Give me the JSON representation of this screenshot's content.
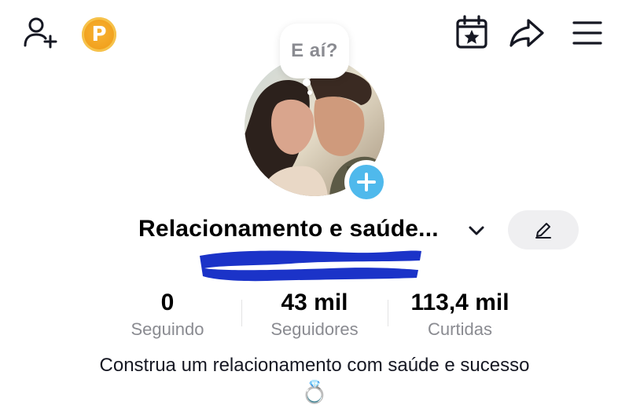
{
  "speech_bubble": {
    "text": "E aí?"
  },
  "header": {
    "add_user_icon": "person-plus-icon",
    "coin_icon": "coin-icon",
    "coin_label": "P",
    "calendar_icon": "calendar-star-icon",
    "share_icon": "share-arrow-icon",
    "menu_icon": "hamburger-menu-icon"
  },
  "profile": {
    "display_name": "Relacionamento e saúde...",
    "edit_icon": "pencil-icon",
    "dropdown_icon": "chevron-down-icon"
  },
  "stats": [
    {
      "value": "0",
      "label": "Seguindo"
    },
    {
      "value": "43 mil",
      "label": "Seguidores"
    },
    {
      "value": "113,4 mil",
      "label": "Curtidas"
    }
  ],
  "bio": {
    "text": "Construa um relacionamento com saúde e sucesso",
    "emoji": "💍"
  },
  "colors": {
    "accent_blue": "#4fb9ec",
    "coin_orange": "#f2a21f",
    "redaction_blue": "#1b33c8",
    "muted_text": "#8a8b91",
    "button_bg": "#efeff1"
  }
}
